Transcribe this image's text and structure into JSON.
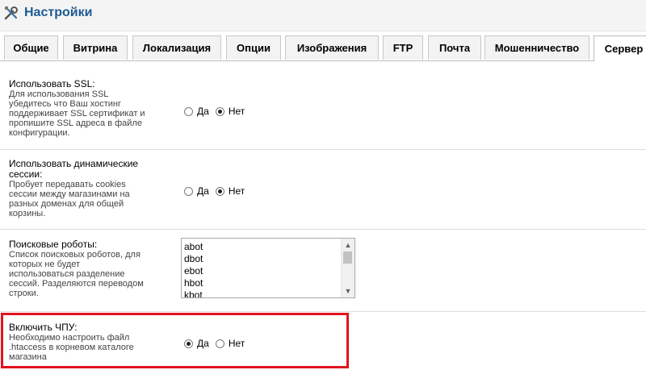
{
  "header": {
    "title": "Настройки",
    "icon": "tools-icon"
  },
  "tabs": [
    {
      "label": "Общие",
      "active": false
    },
    {
      "label": "Витрина",
      "active": false
    },
    {
      "label": "Локализация",
      "active": false
    },
    {
      "label": "Опции",
      "active": false
    },
    {
      "label": "Изображения",
      "active": false
    },
    {
      "label": "FTP",
      "active": false
    },
    {
      "label": "Почта",
      "active": false
    },
    {
      "label": "Мошенничество",
      "active": false
    },
    {
      "label": "Сервер",
      "active": true
    }
  ],
  "settings": {
    "ssl": {
      "title": "Использовать SSL:",
      "help": [
        "Для использования SSL",
        "убедитесь что Ваш хостинг",
        "поддерживает SSL сертификат и",
        "пропишите SSL адреса в файле",
        "конфигурации."
      ],
      "yes": "Да",
      "no": "Нет",
      "selected": "no"
    },
    "sessions": {
      "title": [
        "Использовать динамические",
        "сессии:"
      ],
      "help": [
        "Пробует передавать cookies",
        "сессии между магазинами на",
        "разных доменах для общей",
        "корзины."
      ],
      "yes": "Да",
      "no": "Нет",
      "selected": "no"
    },
    "robots": {
      "title": "Поисковые роботы:",
      "help": [
        "Список поисковых роботов, для",
        "которых не будет",
        "использоваться разделение",
        "сессий. Разделяются переводом",
        "строки."
      ],
      "items": [
        "abot",
        "dbot",
        "ebot",
        "hbot",
        "kbot"
      ]
    },
    "seo_urls": {
      "title": "Включить ЧПУ:",
      "help": [
        "Необходимо настроить файл",
        ".htaccess в корневом каталоге",
        "магазина"
      ],
      "yes": "Да",
      "no": "Нет",
      "selected": "yes"
    }
  },
  "colors": {
    "accent": "#1e5a93",
    "highlight": "#e0141e"
  }
}
